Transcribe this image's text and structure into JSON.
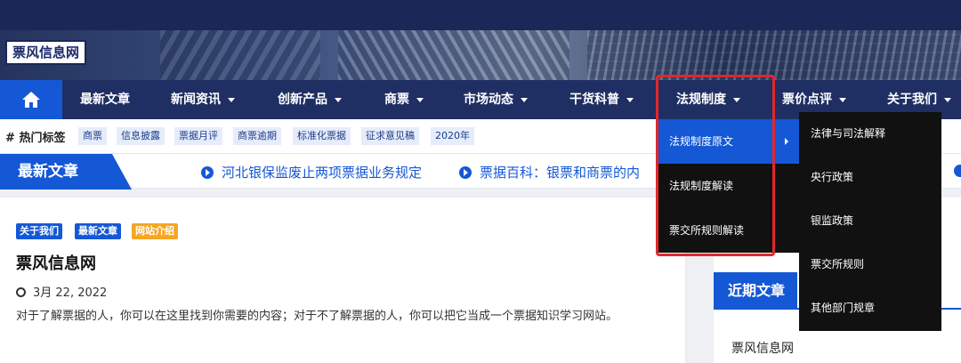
{
  "site": {
    "logo": "票风信息网"
  },
  "nav": {
    "items": [
      {
        "label": "最新文章",
        "dropdown": false
      },
      {
        "label": "新闻资讯",
        "dropdown": true
      },
      {
        "label": "创新产品",
        "dropdown": true
      },
      {
        "label": "商票",
        "dropdown": true
      },
      {
        "label": "市场动态",
        "dropdown": true
      },
      {
        "label": "干货科普",
        "dropdown": true
      },
      {
        "label": "法规制度",
        "dropdown": true
      },
      {
        "label": "票价点评",
        "dropdown": true
      },
      {
        "label": "关于我们",
        "dropdown": true
      }
    ]
  },
  "tags": {
    "label": "热门标签",
    "items": [
      "商票",
      "信息披露",
      "票据月评",
      "商票逾期",
      "标准化票据",
      "征求意见稿",
      "2020年"
    ]
  },
  "ticker": {
    "label": "最新文章",
    "items": [
      "河北银保监废止两项票据业务规定",
      "票据百科：银票和商票的内"
    ]
  },
  "article": {
    "badges": [
      "关于我们",
      "最新文章",
      "网站介绍"
    ],
    "title": "票风信息网",
    "date": "3月 22, 2022",
    "excerpt": "对于了解票据的人，你可以在这里找到你需要的内容；对于不了解票据的人，你可以把它当成一个票据知识学习网站。"
  },
  "sidebar": {
    "heading": "近期文章",
    "items": [
      "票风信息网"
    ]
  },
  "dropdown_regulations": {
    "items": [
      "法规制度原文",
      "法规制度解读",
      "票交所规则解读"
    ],
    "active_index": 0
  },
  "dropdown_submenu": {
    "items": [
      "法律与司法解释",
      "央行政策",
      "银监政策",
      "票交所规则",
      "其他部门规章"
    ]
  },
  "colors": {
    "nav_bg": "#1f2f63",
    "accent": "#1458d6",
    "badge_orange": "#f5a623",
    "highlight": "#e3262a"
  }
}
